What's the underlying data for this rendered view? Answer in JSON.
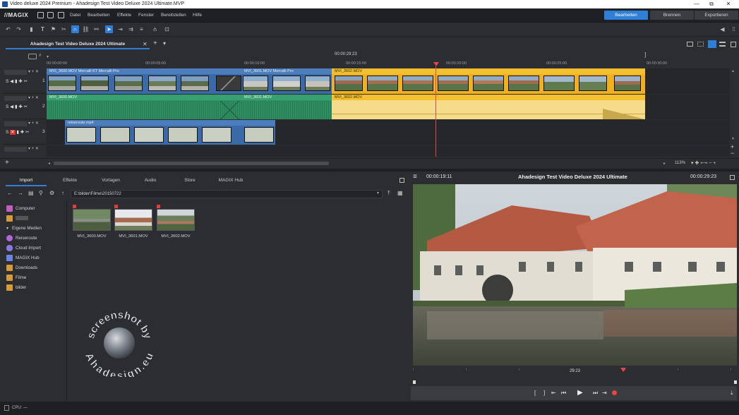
{
  "window": {
    "title": "Video deluxe 2024 Premium - Ahadesign Test Video Deluxe 2024 Ultimate.MVP",
    "minimize": "—",
    "maximize": "▢",
    "restore": "⧉",
    "close": "✕"
  },
  "menubar": {
    "logo": "//MAGIX",
    "items": [
      "Datei",
      "Bearbeiten",
      "Effekte",
      "Fenster",
      "Bereitstellen",
      "Hilfe"
    ],
    "modes": [
      "Bearbeiten",
      "Brennen",
      "Exportieren"
    ]
  },
  "toolbar": {
    "icons": [
      "undo-icon",
      "redo-icon",
      "delete-icon",
      "text-icon",
      "marker-icon",
      "cut-icon",
      "magnet-icon",
      "link-icon",
      "unlink-icon",
      "pointer-icon",
      "trim-icon",
      "ripple-icon",
      "group-icon",
      "split-icon",
      "fit-icon"
    ]
  },
  "project": {
    "tab_label": "Ahadesign Test Video Deluxe 2024 Ultimate",
    "close": "✕",
    "add": "+",
    "dropdown": "▾",
    "duration": "00:00:29:23",
    "zoom": "113%"
  },
  "ruler": {
    "ticks": [
      "00:00:00:00",
      "00:00:05:00",
      "00:00:10:00",
      "00:00:15:00",
      "00:00:20:00",
      "00:00:25:00",
      "00:00:30:00"
    ]
  },
  "tracks": [
    {
      "num": "1",
      "clips": [
        {
          "label": "MVI_3600.MOV   Mercalli KT   Mercalli Pro"
        },
        {
          "label": "MVI_3601.MOV   Mercalli Pro"
        },
        {
          "label": "MVI_3602.MOV"
        }
      ]
    },
    {
      "num": "2",
      "clips": [
        {
          "label": "MVI_3600.MOV"
        },
        {
          "label": "MVI_3601.MOV"
        },
        {
          "label": "MVI_3602.MOV"
        }
      ]
    },
    {
      "num": "3",
      "clips": [
        {
          "label": "reiseroute.mp4"
        }
      ]
    },
    {
      "num": ""
    }
  ],
  "browser": {
    "tabs": [
      "Import",
      "Effekte",
      "Vorlagen",
      "Audio",
      "Store",
      "MAGIX Hub"
    ],
    "path": "E:\\bilder\\Filme\\20150722",
    "sidebar": [
      {
        "label": "Computer",
        "icon": "computer-icon",
        "color": "#c25fc1"
      },
      {
        "label": "",
        "icon": "user-folder-icon",
        "color": "#d69a38"
      },
      {
        "label": "Eigene Medien",
        "icon": "chevron-down-icon",
        "color": ""
      },
      {
        "label": "Reiseroute",
        "icon": "pin-icon",
        "color": "#b667d6"
      },
      {
        "label": "Cloud Import",
        "icon": "cloud-icon",
        "color": "#8a78e0"
      },
      {
        "label": "MAGIX Hub",
        "icon": "hub-icon",
        "color": "#6b84e6"
      },
      {
        "label": "Downloads",
        "icon": "download-icon",
        "color": "#d69a38"
      },
      {
        "label": "Filme",
        "icon": "folder-icon",
        "color": "#d69a38"
      },
      {
        "label": "bilder",
        "icon": "folder-icon",
        "color": "#d69a38"
      }
    ],
    "files": [
      {
        "name": "MVI_3600.MOV"
      },
      {
        "name": "MVI_3601.MOV"
      },
      {
        "name": "MVI_3602.MOV"
      }
    ],
    "watermark_top": "screenshot by",
    "watermark_bottom": "Ahadesign.eu"
  },
  "preview": {
    "time_left": "00:00:19:11",
    "title": "Ahadesign Test Video Deluxe 2024 Ultimate",
    "time_right": "00:00:29:23",
    "scrub_label": "29:23"
  },
  "status": {
    "cpu": "CPU: —"
  }
}
